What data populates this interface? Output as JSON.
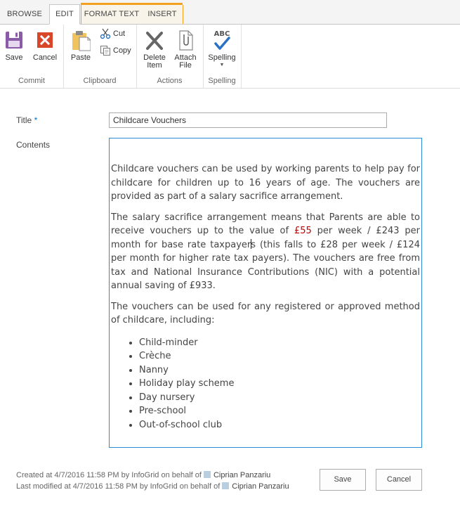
{
  "tabs": {
    "browse": "BROWSE",
    "edit": "EDIT",
    "format_text": "FORMAT TEXT",
    "insert": "INSERT"
  },
  "ribbon": {
    "commit": {
      "label": "Commit",
      "save": "Save",
      "cancel": "Cancel"
    },
    "clipboard": {
      "label": "Clipboard",
      "paste": "Paste",
      "cut": "Cut",
      "copy": "Copy"
    },
    "actions": {
      "label": "Actions",
      "delete_line1": "Delete",
      "delete_line2": "Item",
      "attach_line1": "Attach",
      "attach_line2": "File"
    },
    "spelling": {
      "label": "Spelling",
      "spelling": "Spelling",
      "abc": "ABC"
    }
  },
  "form": {
    "title_label": "Title",
    "required_mark": "*",
    "title_value": "Childcare Vouchers",
    "contents_label": "Contents",
    "contents": {
      "para1": "Childcare vouchers can be used by working parents to help pay for childcare for children up to 16 years of age. The vouchers are provided as part of a salary sacrifice arrangement.",
      "para2_a": "The salary sacrifice arrangement means that Parents are able to receive vouchers up to the value of ",
      "para2_highlight": "£55",
      "para2_b": " per week / £243 per month for base rate taxpayer",
      "para2_c": "s (this falls to £28 per week / £124 per month for higher rate tax payers). The vouchers are free from tax and National Insurance Contributions (NIC) with a potential annual saving of £933.",
      "para3": "The vouchers can be used for any registered or approved method of childcare, including:",
      "list": [
        "Child-minder",
        "Crèche",
        "Nanny",
        "Holiday play scheme",
        "Day nursery",
        "Pre-school",
        "Out-of-school club"
      ]
    }
  },
  "footer": {
    "created_prefix": "Created at 4/7/2016 11:58 PM  by InfoGrid on behalf of",
    "created_user": "Ciprian Panzariu",
    "modified_prefix": "Last modified at 4/7/2016 11:58 PM  by InfoGrid on behalf of",
    "modified_user": "Ciprian Panzariu",
    "save": "Save",
    "cancel": "Cancel"
  },
  "colors": {
    "accent": "#2a8dd4",
    "context_tab": "#f2a11f",
    "highlight_text": "#c00000",
    "save_icon": "#8a5ca8",
    "cancel_icon": "#d9472b",
    "spell_check": "#2a72c3"
  },
  "icons": {
    "save": "save-icon",
    "cancel": "cancel-icon",
    "paste": "paste-icon",
    "cut": "scissors-icon",
    "copy": "copy-icon",
    "delete": "delete-icon",
    "attach": "paperclip-icon",
    "spelling": "spellcheck-icon"
  }
}
